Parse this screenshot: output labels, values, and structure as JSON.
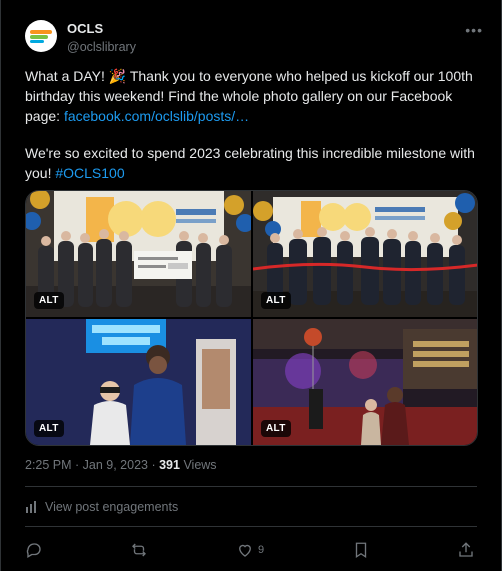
{
  "author": {
    "display_name": "OCLS",
    "handle": "@oclslibrary"
  },
  "post": {
    "para1_text": "What a DAY! 🎉 Thank you to everyone who helped us kickoff our 100th birthday this weekend! Find the whole photo gallery on our Facebook page: ",
    "para1_link": "facebook.com/oclslib/posts/…",
    "para2_text": "We're so excited to spend 2023 celebrating this incredible milestone with you! ",
    "hashtag": "#OCLS100"
  },
  "media": [
    {
      "alt_label": "ALT"
    },
    {
      "alt_label": "ALT"
    },
    {
      "alt_label": "ALT"
    },
    {
      "alt_label": "ALT"
    }
  ],
  "meta": {
    "time_date": "2:25 PM · Jan 9, 2023 · ",
    "views_count": "391",
    "views_label": " Views"
  },
  "engagements_label": "View post engagements",
  "actions": {
    "likes_count": "9"
  },
  "icons": [
    "more-icon",
    "engagements-icon",
    "reply-icon",
    "repost-icon",
    "like-icon",
    "bookmark-icon",
    "share-icon"
  ]
}
